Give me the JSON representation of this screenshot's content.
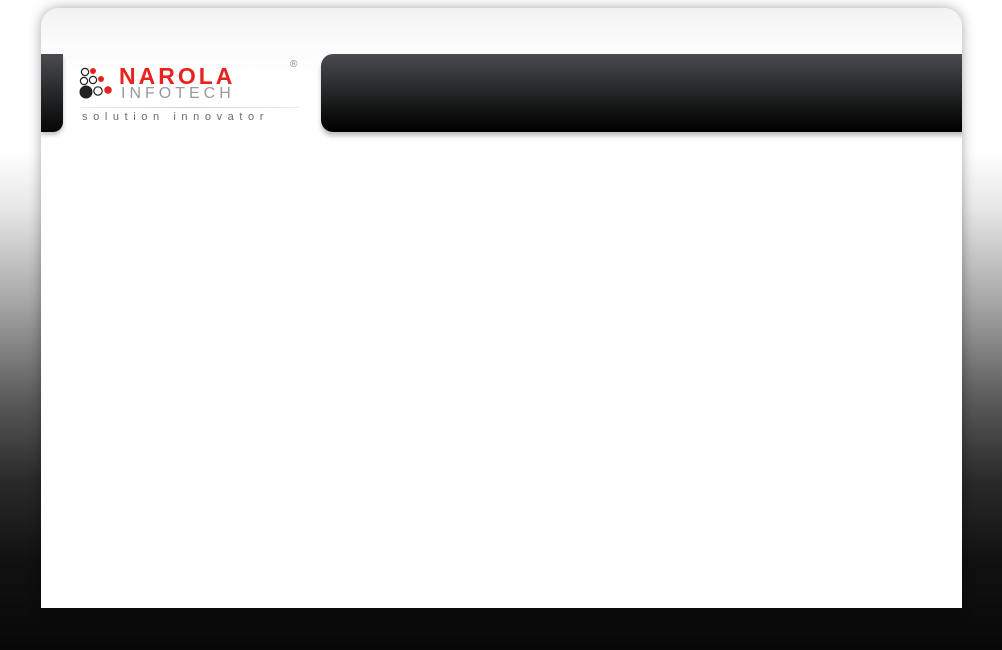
{
  "brand": {
    "name": "NAROLA",
    "subname": "INFOTECH",
    "tagline": "solution innovator",
    "registered_mark": "®",
    "logo_icon": "circles-logo-icon",
    "colors": {
      "accent": "#e8231f",
      "sub": "#9a9a9a",
      "tagline": "#6a6a6a"
    }
  },
  "header": {
    "bar_color": "#000000"
  }
}
